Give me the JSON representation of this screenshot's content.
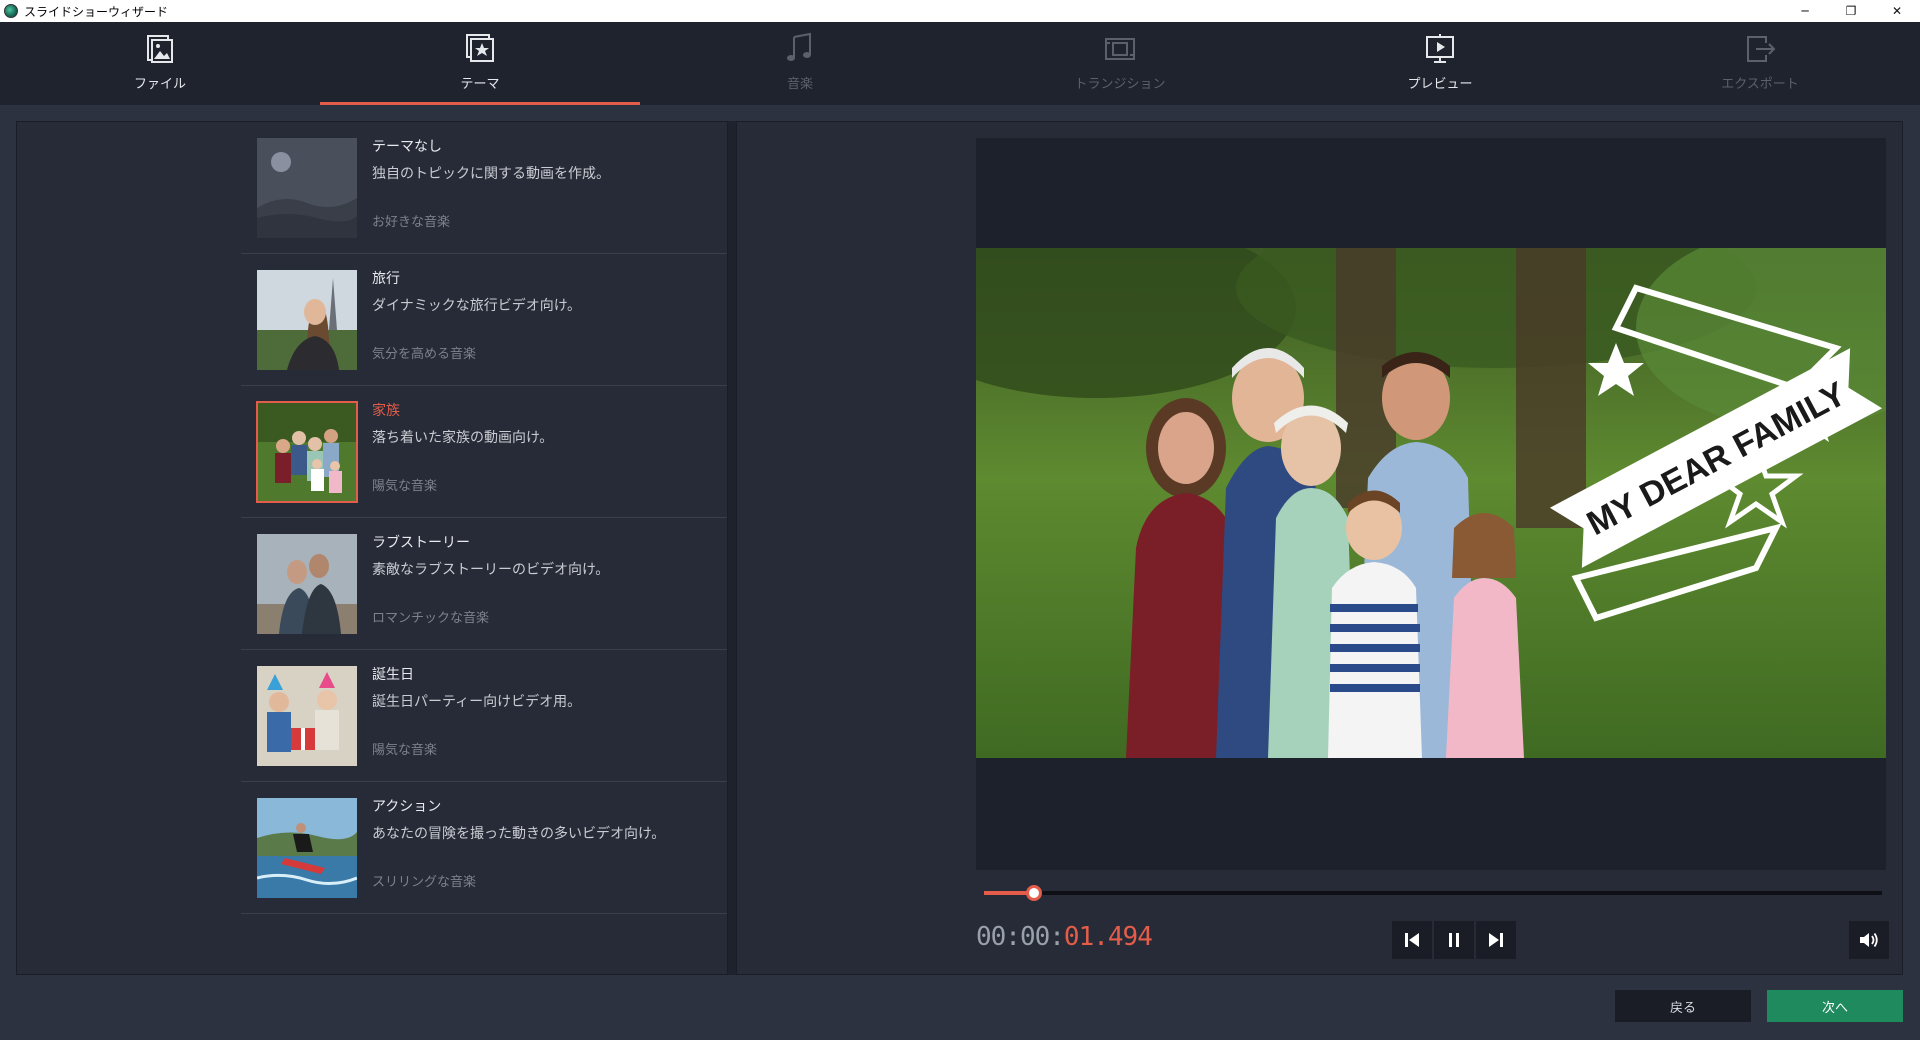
{
  "window": {
    "title": "スライドショーウィザード",
    "minimize": "─",
    "restore": "❐",
    "close": "✕"
  },
  "nav": {
    "tabs": [
      {
        "label": "ファイル",
        "icon": "file-image-icon",
        "state": "enabled"
      },
      {
        "label": "テーマ",
        "icon": "theme-star-icon",
        "state": "active"
      },
      {
        "label": "音楽",
        "icon": "music-note-icon",
        "state": "disabled"
      },
      {
        "label": "トランジション",
        "icon": "transition-icon",
        "state": "disabled"
      },
      {
        "label": "プレビュー",
        "icon": "preview-play-icon",
        "state": "enabled"
      },
      {
        "label": "エクスポート",
        "icon": "export-icon",
        "state": "disabled"
      }
    ]
  },
  "themes": [
    {
      "name": "テーマなし",
      "desc": "独自のトピックに関する動画を作成。",
      "music": "お好きな音楽",
      "selected": false
    },
    {
      "name": "旅行",
      "desc": "ダイナミックな旅行ビデオ向け。",
      "music": "気分を高める音楽",
      "selected": false
    },
    {
      "name": "家族",
      "desc": "落ち着いた家族の動画向け。",
      "music": "陽気な音楽",
      "selected": true
    },
    {
      "name": "ラブストーリー",
      "desc": "素敵なラブストーリーのビデオ向け。",
      "music": "ロマンチックな音楽",
      "selected": false
    },
    {
      "name": "誕生日",
      "desc": "誕生日パーティー向けビデオ用。",
      "music": "陽気な音楽",
      "selected": false
    },
    {
      "name": "アクション",
      "desc": "あなたの冒険を撮った動きの多いビデオ向け。",
      "music": "スリリングな音楽",
      "selected": false
    }
  ],
  "preview": {
    "banner_text": "MY DEAR FAMILY",
    "progress": 0.056,
    "timecode_dim": "00:00:",
    "timecode_hi": "01.494"
  },
  "buttons": {
    "back": "戻る",
    "next": "次へ"
  },
  "colors": {
    "accent": "#e35d4a",
    "next_button": "#1f8a5e"
  }
}
